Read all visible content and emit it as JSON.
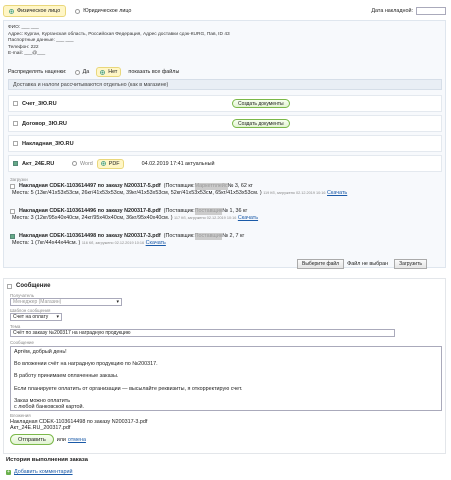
{
  "tabs": {
    "physical": "Физическое лицо",
    "legal": "Юридическое лицо",
    "date_label": "Дата накладной:"
  },
  "client": {
    "lines": [
      "ФИО: ___ ___",
      "Адрес: Курган, Курганская область, Российская Федерация, Адрес доставки сдэк-КURG, Пав, ID 43",
      "Паспортные данные: ___ ___",
      "Телефон: 222",
      "E-mail: ___@___"
    ]
  },
  "markup": {
    "label": "Распределять наценки:",
    "yes": "Да",
    "no": "Нет",
    "show_all": "показать все файлы"
  },
  "notice": "Доставка и налоги рассчитываются отдельно (как в магазине)",
  "docs": [
    {
      "name": "Счет_3Ю.RU",
      "button": "Создать документы"
    },
    {
      "name": "Договор_3Ю.RU",
      "button": "Создать документы"
    },
    {
      "name": "Накладная_3Ю.RU"
    },
    {
      "name": "Акт_24Е.RU",
      "opt1": "Word",
      "opt2": "PDF",
      "status": "04.02.2019 17:41 актуальный"
    }
  ],
  "upload_label": "Загрузки",
  "uploads": [
    {
      "title": "Накладная CDEK-1103614497 по заказу N200317-5.pdf",
      "supplier": "(Поставщик: ",
      "supplier_name": "Маркетплейс",
      "supplier_rest": " № 3, 62 кг",
      "places": "Места: 5 (13кг/41х53х53см, 26кг/41х53х53см, 39кг/41х53х53см, 52кг/41х53х53см, 65кг/41х53х53см. )",
      "meta": "119 Кб, загружено 02.12.2019 10:16",
      "download": "Скачать"
    },
    {
      "title": "Накладная CDEK-1103614496 по заказу N200317-8.pdf",
      "supplier": "(Поставщик: ",
      "supplier_name": "Поставщик",
      "supplier_rest": " № 1, 36 кг",
      "places": "Места: 3 (12кг/95х40х40см, 24кг/95х40х40см, 36кг/95х40х40см. )",
      "meta": "117 Кб, загружено 02.12.2019 10:16",
      "download": "Скачать"
    },
    {
      "title": "Накладная CDEK-1103614498 по заказу N200317-3.pdf",
      "supplier": "(Поставщик: ",
      "supplier_name": "Поставщик",
      "supplier_rest": " № 2, 7 кг",
      "places": "Места: 1 (7кг/44х44х44см. )",
      "meta": "116 Кб, загружено 02.12.2019 10:16",
      "download": "Скачать"
    }
  ],
  "file": {
    "choose": "Выберите файл",
    "none": "Файл не выбран",
    "upload": "Загрузить"
  },
  "message": {
    "header": "Сообщение",
    "recipient_label": "Получатель",
    "recipient_value": "Менеджер (Магазин)",
    "template_label": "Шаблон сообщения",
    "template_value": "Счет на оплату",
    "subject_label": "Тема",
    "subject_value": "Счёт по заказу №200317 на наградную продукцию",
    "body_label": "Сообщение",
    "body_lines": [
      "Артём, добрый день!",
      "",
      "Во вложении счёт на наградную продукцию по №200317.",
      "",
      "В работу принимаем оплаченные заказы.",
      "",
      "Если планируете оплатить от организации — высылайте реквизиты, я откорректирую счет.",
      "",
      "Заказ можно оплатить",
      "с любой банковской картой."
    ],
    "attachments_label": "Вложения",
    "attachments": [
      "Накладная CDEK-1103614498 по заказу N200317-3.pdf",
      "Акт_24Е.RU_200317.pdf"
    ],
    "send": "Отправить",
    "or": "или",
    "cancel": "отмена"
  },
  "history": {
    "title": "История выполнения заказа",
    "add_comment": "Добавить комментарий"
  }
}
